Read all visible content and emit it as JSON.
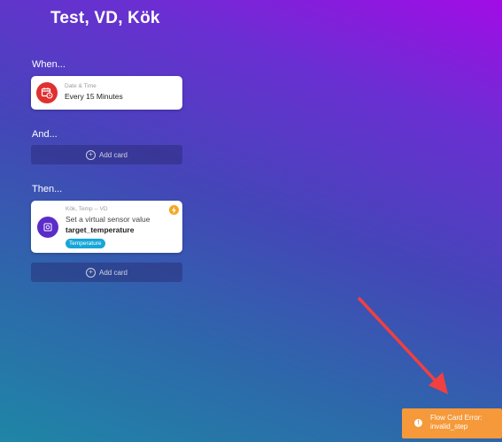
{
  "flow": {
    "title": "Test, VD, Kök"
  },
  "sections": {
    "when": "When...",
    "and": "And...",
    "then": "Then..."
  },
  "when_card": {
    "category": "Date & Time",
    "text_prefix": "Every",
    "value": "15 Minutes",
    "icon": "calendar-clock-icon",
    "icon_color": "#e03030"
  },
  "and_add": {
    "label": "Add card",
    "icon": "plus-circle-icon"
  },
  "then_card": {
    "device": "Kök, Temp -- VD",
    "action": "Set a virtual sensor value",
    "capability": "target_temperature",
    "badge": "Temperature",
    "icon": "virtual-device-icon",
    "icon_color": "#5b2cc9",
    "flash_icon": "lightning-icon",
    "flash_color": "#f5a623"
  },
  "then_add": {
    "label": "Add card",
    "icon": "plus-circle-icon"
  },
  "toast": {
    "icon": "info-icon",
    "line1": "Flow Card Error:",
    "line2": "invalid_step",
    "color": "#f5993a"
  },
  "annotation": {
    "icon": "red-arrow-icon",
    "color": "#f04040"
  }
}
